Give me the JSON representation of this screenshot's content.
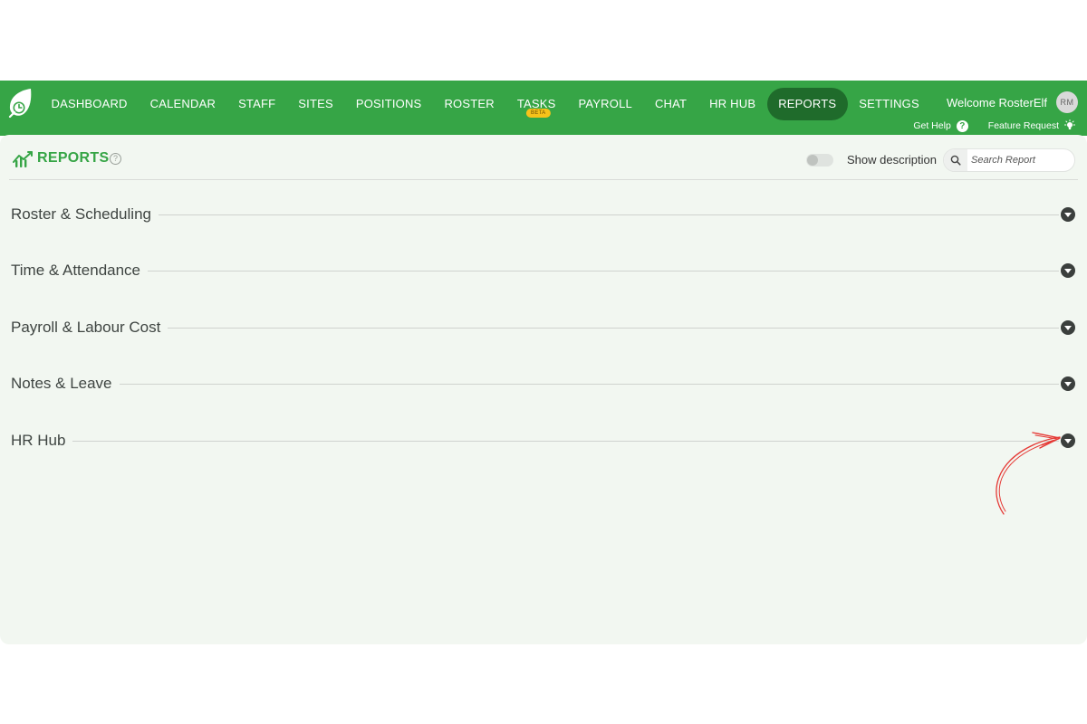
{
  "nav": {
    "items": [
      {
        "label": "DASHBOARD",
        "active": false
      },
      {
        "label": "CALENDAR",
        "active": false
      },
      {
        "label": "STAFF",
        "active": false
      },
      {
        "label": "SITES",
        "active": false
      },
      {
        "label": "POSITIONS",
        "active": false
      },
      {
        "label": "ROSTER",
        "active": false
      },
      {
        "label": "TASKS",
        "active": false,
        "badge": "BETA"
      },
      {
        "label": "PAYROLL",
        "active": false
      },
      {
        "label": "CHAT",
        "active": false
      },
      {
        "label": "HR HUB",
        "active": false
      },
      {
        "label": "REPORTS",
        "active": true
      },
      {
        "label": "SETTINGS",
        "active": false
      }
    ]
  },
  "user": {
    "welcome": "Welcome RosterElf",
    "initials": "RM"
  },
  "help": {
    "get_help": "Get Help",
    "feature_request": "Feature Request"
  },
  "page": {
    "title": "REPORTS",
    "info_glyph": "?",
    "show_description": "Show description",
    "show_description_on": false,
    "search_placeholder": "Search Report"
  },
  "sections": [
    {
      "label": "Roster & Scheduling"
    },
    {
      "label": "Time & Attendance"
    },
    {
      "label": "Payroll & Labour Cost"
    },
    {
      "label": "Notes & Leave"
    },
    {
      "label": "HR Hub"
    }
  ],
  "colors": {
    "brand_green": "#36a546",
    "active_nav": "#1f6b2b",
    "panel_bg": "#f2f7f1",
    "beta_badge": "#f7c21a",
    "annotation_arrow": "#e53935"
  },
  "icons": {
    "logo": "rosterelf-leaf-clock-logo",
    "reports": "bar-chart-trend-icon",
    "help": "question-circle-icon",
    "feature": "lightbulb-icon",
    "search": "search-icon",
    "expand": "chevron-down-circle-icon"
  }
}
